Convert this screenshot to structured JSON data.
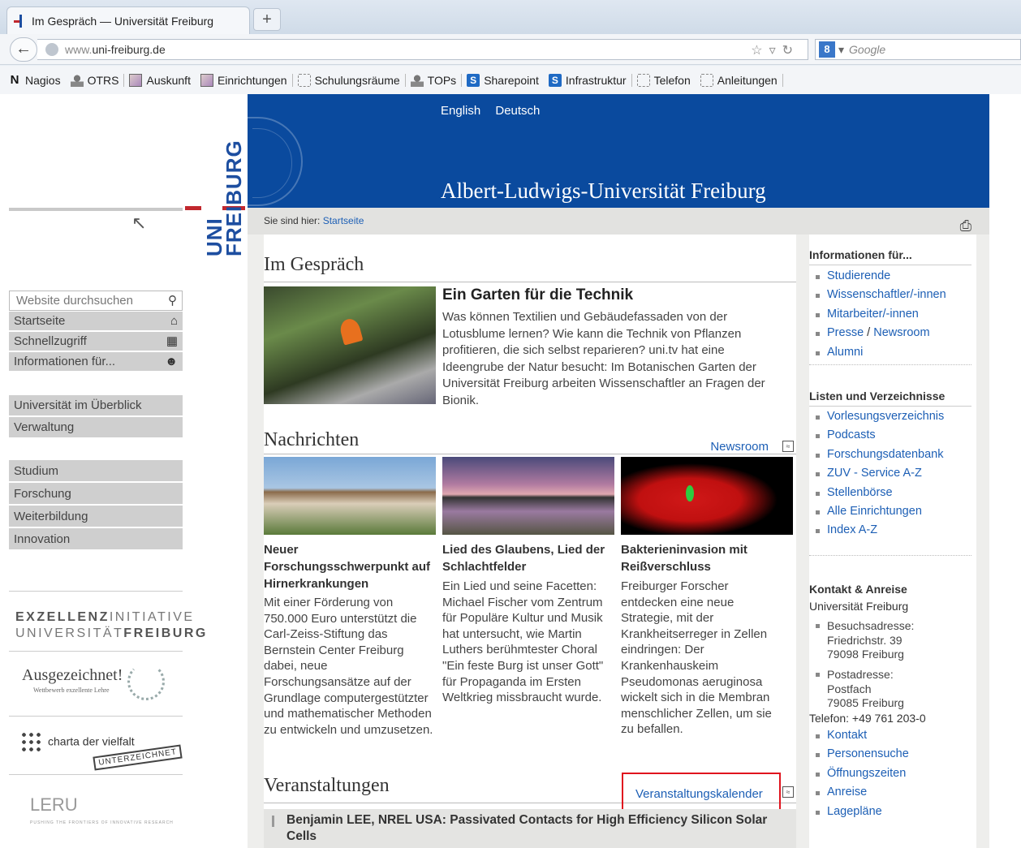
{
  "browser": {
    "tab_title": "Im Gespräch — Universität Freiburg",
    "new_tab": "+",
    "url_prefix": "www.",
    "url_domain": "uni-freiburg.de",
    "search_placeholder": "Google",
    "search_engine_badge": "8",
    "bookmarks": [
      {
        "label": "Nagios",
        "icon": "nagios-n-icon"
      },
      {
        "label": "OTRS",
        "icon": "person-icon"
      },
      {
        "label": "Auskunft",
        "icon": "picture-icon"
      },
      {
        "label": "Einrichtungen",
        "icon": "picture-icon"
      },
      {
        "label": "Schulungsräume",
        "icon": "folder-dotted-icon"
      },
      {
        "label": "TOPs",
        "icon": "person-icon"
      },
      {
        "label": "Sharepoint",
        "icon": "sharepoint-icon"
      },
      {
        "label": "Infrastruktur",
        "icon": "sharepoint-icon"
      },
      {
        "label": "Telefon",
        "icon": "folder-dotted-icon"
      },
      {
        "label": "Anleitungen",
        "icon": "folder-dotted-icon"
      }
    ]
  },
  "header": {
    "lang_en": "English",
    "lang_de": "Deutsch",
    "site_title": "Albert-Ludwigs-Universität Freiburg",
    "logo_text_1": "UNI",
    "logo_text_2": "FREIBURG"
  },
  "leftnav": {
    "search_placeholder": "Website durchsuchen",
    "group1": [
      "Startseite",
      "Schnellzugriff",
      "Informationen für..."
    ],
    "group2": [
      "Universität im Überblick",
      "Verwaltung"
    ],
    "group3": [
      "Studium",
      "Forschung",
      "Weiterbildung",
      "Innovation"
    ],
    "exz_line1_bold": "EXZELLENZ",
    "exz_line1": "INITIATIVE",
    "exz_line2": "UNIVERSITÄT",
    "exz_line2_bold": "FREIBURG",
    "ausg_title": "Ausgezeichnet!",
    "ausg_sub": "Wettbewerb exzellente Lehre",
    "charta": "charta der vielfalt",
    "charta_stamp": "UNTERZEICHNET",
    "leru": "LERU",
    "leru_sub": "PUSHING THE FRONTIERS OF INNOVATIVE RESEARCH"
  },
  "breadcrumb": {
    "prefix": "Sie sind hier:",
    "link": "Startseite"
  },
  "main": {
    "sec1": "Im Gespräch",
    "feature_title": "Ein Garten für die Technik",
    "feature_text": "Was können Textilien und Gebäudefassaden von der Lotusblume lernen? Wie kann die Technik von Pflanzen profitieren, die sich selbst reparieren? uni.tv hat eine Ideengrube der Natur besucht: Im Botanischen Garten der Universität Freiburg arbeiten Wissenschaftler an Fragen der Bionik.",
    "sec2": "Nachrichten",
    "newsroom": "Newsroom",
    "news": [
      {
        "title": "Neuer Forschungsschwerpunkt auf Hirnerkrankungen",
        "text": "Mit einer Förderung von 750.000 Euro unterstützt die Carl-Zeiss-Stiftung das Bernstein Center Freiburg dabei, neue Forschungsansätze auf der Grundlage computergestützter und mathematischer Methoden zu entwickeln und umzusetzen."
      },
      {
        "title": "Lied des Glaubens, Lied der Schlachtfelder",
        "text": "Ein Lied und seine Facetten: Michael Fischer vom Zentrum für Populäre Kultur und Musik hat untersucht, wie Martin Luthers berühmtester Choral \"Ein feste Burg ist unser Gott\" für Propaganda im Ersten Weltkrieg missbraucht wurde."
      },
      {
        "title": "Bakterieninvasion mit Reißverschluss",
        "text": "Freiburger Forscher entdecken eine neue Strategie, mit der Krankheitserreger in Zellen eindringen: Der Krankenhauskeim Pseudomonas aeruginosa wickelt sich in die Membran menschlicher Zellen, um sie zu befallen."
      }
    ],
    "sec3": "Veranstaltungen",
    "calendar": "Veranstaltungskalender",
    "event": "Benjamin LEE, NREL USA: Passivated Contacts for High Efficiency Silicon Solar Cells"
  },
  "sidebar": {
    "info_head": "Informationen für...",
    "info_items": [
      "Studierende",
      "Wissenschaftler/-innen",
      "Mitarbeiter/-innen"
    ],
    "presse": "Presse",
    "slash": " / ",
    "newsroom": "Newsroom",
    "alumni": "Alumni",
    "lists_head": "Listen und Verzeichnisse",
    "lists_items": [
      "Vorlesungsverzeichnis",
      "Podcasts",
      "Forschungsdatenbank",
      "ZUV - Service A-Z",
      "Stellenbörse",
      "Alle Einrichtungen",
      "Index A-Z"
    ],
    "contact_head": "Kontakt & Anreise",
    "uni": "Universität Freiburg",
    "visit": [
      "Besuchsadresse:",
      "Friedrichstr. 39",
      "79098 Freiburg"
    ],
    "post": [
      "Postadresse:",
      "Postfach",
      "79085 Freiburg"
    ],
    "phone": "Telefon: +49 761 203-0",
    "contact_items": [
      "Kontakt",
      "Personensuche",
      "Öffnungszeiten",
      "Anreise",
      "Lagepläne"
    ]
  }
}
